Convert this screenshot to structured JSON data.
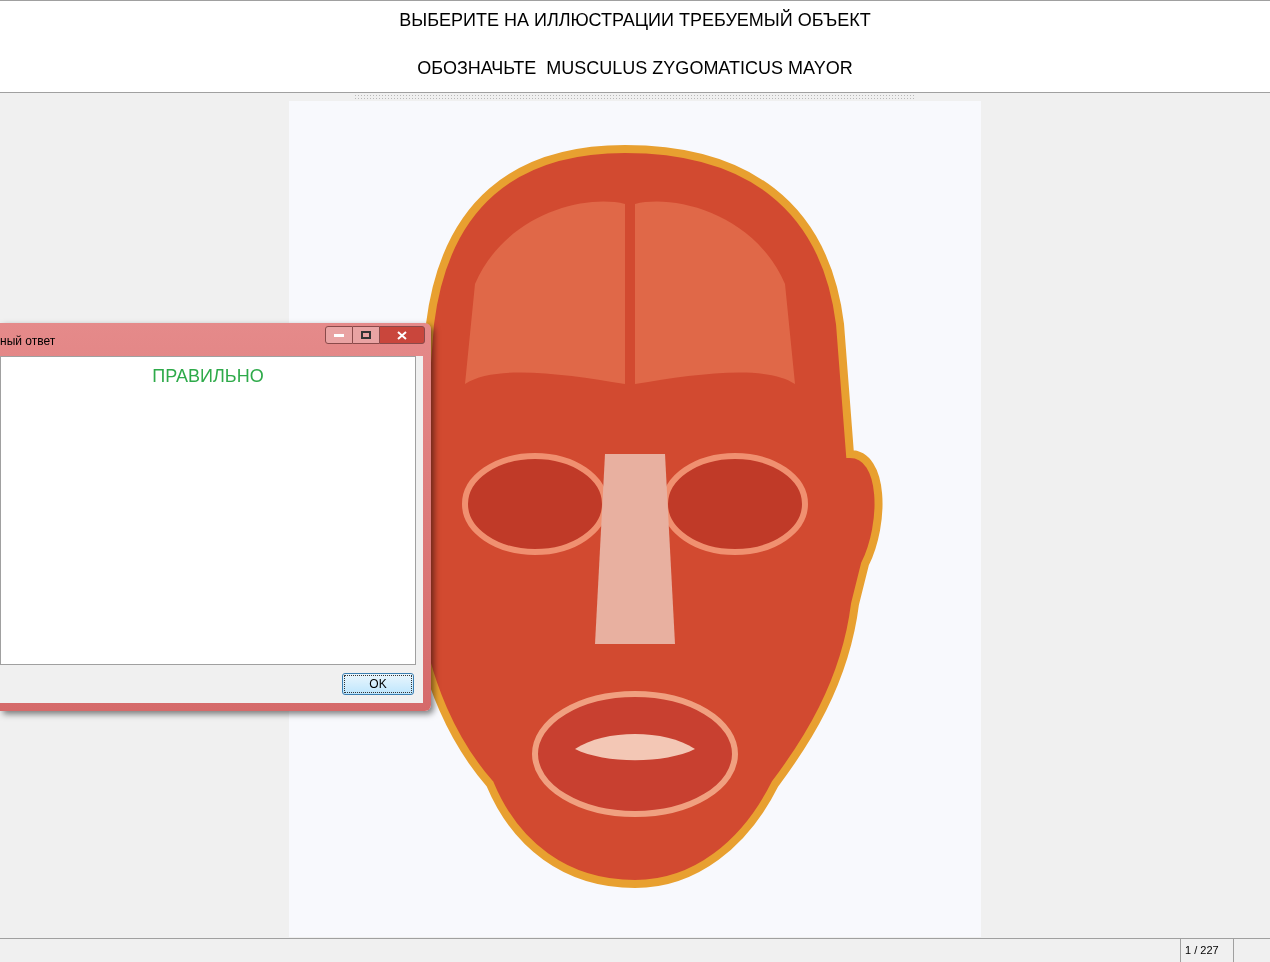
{
  "header": {
    "instruction": "ВЫБЕРИТЕ НА ИЛЛЮСТРАЦИИ ТРЕБУЕМЫЙ ОБЪЕКТ",
    "task": "ОБОЗНАЧЬТЕ  MUSCULUS ZYGOMATICUS MAYOR"
  },
  "dialog": {
    "title": "ный ответ",
    "message": "ПРАВИЛЬНО",
    "button": "OK"
  },
  "status_bar": {
    "page": "1 / 227"
  }
}
